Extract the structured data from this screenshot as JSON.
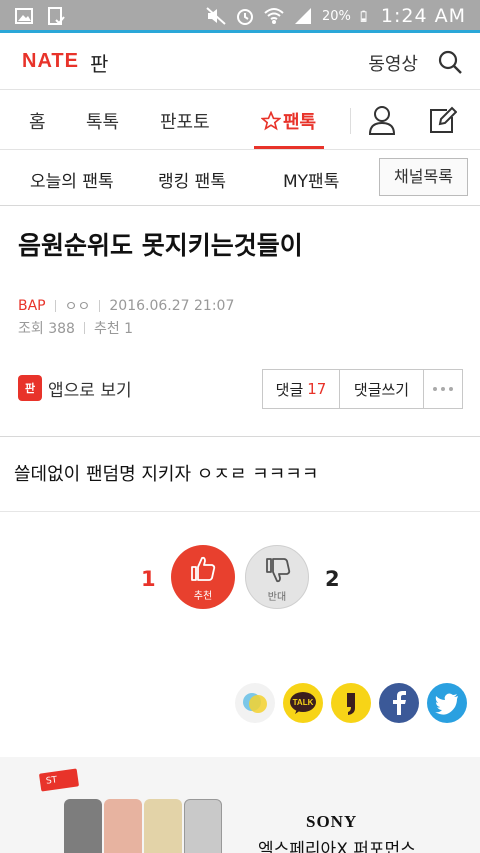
{
  "status_bar": {
    "battery_pct": "20%",
    "time": "1:24 AM",
    "icons": [
      "image-icon",
      "clipboard-check-icon",
      "mute-icon",
      "alarm-icon",
      "wifi-icon",
      "signal-icon",
      "battery-icon"
    ]
  },
  "header": {
    "logo": "NATE",
    "logo_sub": "판",
    "video_link": "동영상",
    "search_icon": "search-icon"
  },
  "tabs": {
    "items": [
      "홈",
      "톡톡",
      "판포토",
      "팬톡"
    ],
    "active_index": 3,
    "active_icon": "star-icon",
    "user_icon": "user-icon",
    "write_icon": "edit-icon"
  },
  "subtabs": {
    "items": [
      "오늘의 팬톡",
      "랭킹 팬톡",
      "MY팬톡"
    ],
    "channel_button": "채널목록"
  },
  "post": {
    "title": "음원순위도 못지키는것들이",
    "channel": "BAP",
    "author": "ㅇㅇ",
    "datetime": "2016.06.27 21:07",
    "views": "조회 388",
    "recommends": "추천 1",
    "app_view": "앱으로 보기",
    "app_icon_text": "판",
    "comment_label": "댓글",
    "comment_count": "17",
    "comment_write": "댓글쓰기",
    "more_icon": "more-icon",
    "body": "쓸데없이 팬덤명 지키자 ㅇㅈㄹ ㅋㅋㅋㅋ"
  },
  "votes": {
    "up_count": "1",
    "up_label": "추천",
    "down_count": "2",
    "down_label": "반대"
  },
  "share": {
    "icons": [
      "nateon-icon",
      "kakaotalk-icon",
      "kakaostory-icon",
      "facebook-icon",
      "twitter-icon"
    ],
    "kakaotalk_text": "TALK",
    "colors": {
      "kakao": "#f7d417",
      "facebook": "#3b5998",
      "twitter": "#2aa0e0"
    }
  },
  "ad": {
    "brand": "SONY",
    "title": "엑스페리아X 퍼포먼스",
    "tag": "ST"
  },
  "colors": {
    "accent": "#e8332a",
    "status_bar": "#a8a8a8"
  }
}
